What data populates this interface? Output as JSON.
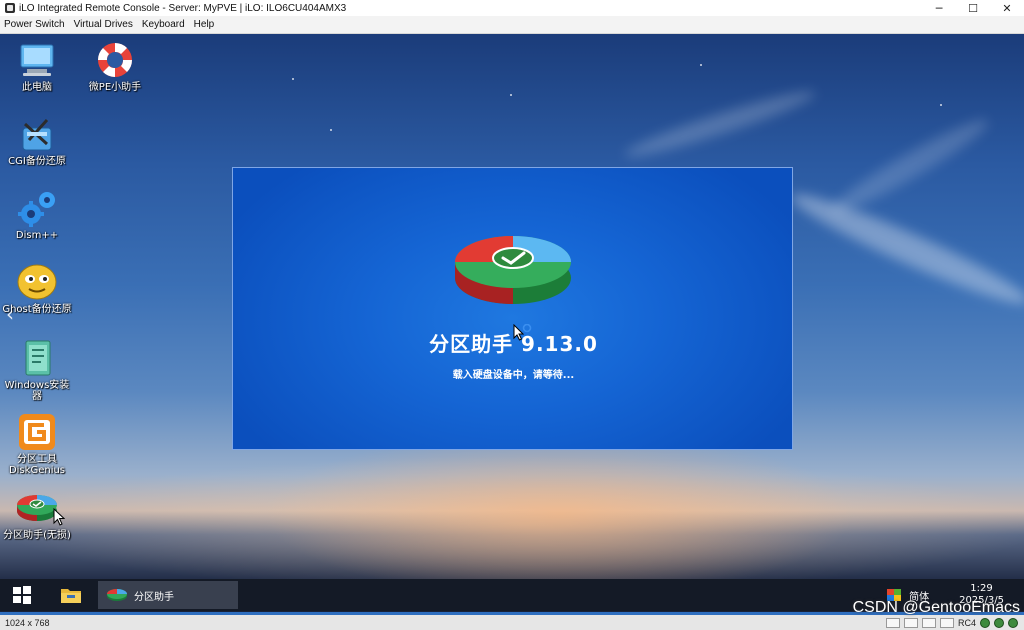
{
  "window": {
    "title": "iLO Integrated Remote Console - Server: MyPVE | iLO: ILO6CU404AMX3",
    "controls": {
      "minimize": "─",
      "maximize": "☐",
      "close": "✕"
    }
  },
  "menubar": {
    "items": [
      "Power Switch",
      "Virtual Drives",
      "Keyboard",
      "Help"
    ]
  },
  "desktop": {
    "icons": [
      {
        "label": "此电脑",
        "icon": "computer-icon"
      },
      {
        "label": "微PE小助手",
        "icon": "lifebuoy-icon"
      },
      {
        "label": "CGI备份还原",
        "icon": "cgi-backup-icon"
      },
      {
        "label": "Dism++",
        "icon": "gears-icon"
      },
      {
        "label": "Ghost备份还原",
        "icon": "ghost-icon"
      },
      {
        "label": "Windows安装器",
        "icon": "windows-installer-icon"
      },
      {
        "label": "分区工具DiskGenius",
        "icon": "diskgenius-icon"
      },
      {
        "label": "分区助手(无损)",
        "icon": "partition-assistant-icon"
      }
    ]
  },
  "splash": {
    "app_name": "分区助手 9.13.0",
    "status": "载入硬盘设备中，请等待..."
  },
  "taskbar": {
    "task_label": "分区助手",
    "language": "简体",
    "time": "1:29",
    "date": "2025/3/5"
  },
  "statusbar": {
    "resolution": "1024 x 768",
    "rc": "RC4"
  },
  "watermark": "CSDN @GentooEmacs",
  "colors": {
    "splash_blue": "#1565d4",
    "taskbar": "#141a26",
    "accent": "#2f6fc0"
  }
}
